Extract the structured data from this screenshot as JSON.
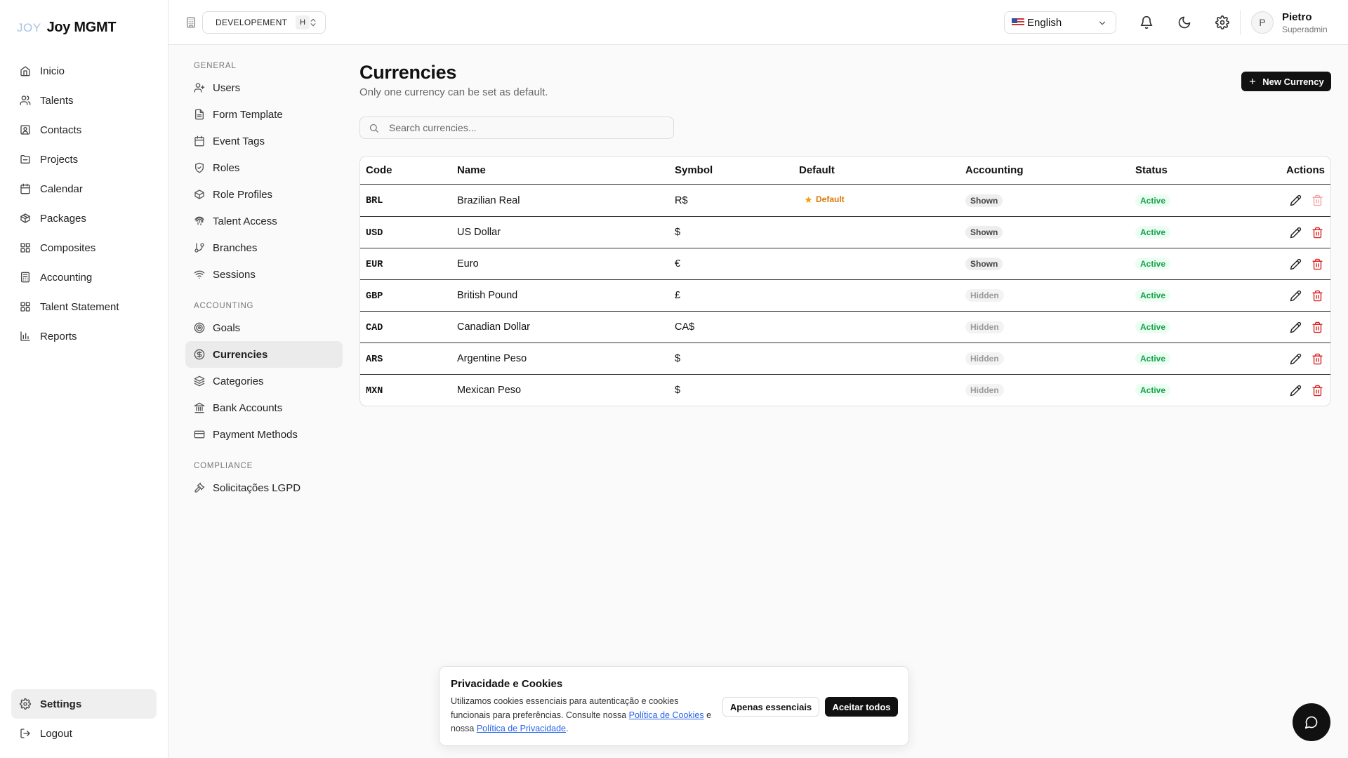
{
  "brand": {
    "logo": "JOY",
    "name": "Joy MGMT"
  },
  "sidebar": {
    "items": [
      {
        "label": "Inicio",
        "icon": "home-icon"
      },
      {
        "label": "Talents",
        "icon": "users-icon"
      },
      {
        "label": "Contacts",
        "icon": "contact-icon"
      },
      {
        "label": "Projects",
        "icon": "folder-icon"
      },
      {
        "label": "Calendar",
        "icon": "calendar-icon"
      },
      {
        "label": "Packages",
        "icon": "package-icon"
      },
      {
        "label": "Composites",
        "icon": "grid-icon"
      },
      {
        "label": "Accounting",
        "icon": "calculator-icon"
      },
      {
        "label": "Talent Statement",
        "icon": "grid-icon"
      },
      {
        "label": "Reports",
        "icon": "bar-chart-icon"
      }
    ],
    "settings_label": "Settings",
    "logout_label": "Logout"
  },
  "topbar": {
    "environment": "DEVELOPEMENT",
    "environment_badge": "H",
    "language": "English",
    "user_initial": "P",
    "user_name": "Pietro",
    "user_role": "Superadmin"
  },
  "subnav": {
    "general_label": "GENERAL",
    "general": [
      "Users",
      "Form Template",
      "Event Tags",
      "Roles",
      "Role Profiles",
      "Talent Access",
      "Branches",
      "Sessions"
    ],
    "accounting_label": "ACCOUNTING",
    "accounting": [
      "Goals",
      "Currencies",
      "Categories",
      "Bank Accounts",
      "Payment Methods"
    ],
    "compliance_label": "COMPLIANCE",
    "compliance": [
      "Solicitações LGPD"
    ]
  },
  "main": {
    "title": "Currencies",
    "subtitle": "Only one currency can be set as default.",
    "new_button": "New Currency",
    "search_placeholder": "Search currencies..."
  },
  "table": {
    "headers": {
      "code": "Code",
      "name": "Name",
      "symbol": "Symbol",
      "default": "Default",
      "accounting": "Accounting",
      "status": "Status",
      "actions": "Actions"
    },
    "rows": [
      {
        "code": "BRL",
        "name": "Brazilian Real",
        "symbol": "R$",
        "default": "Default",
        "accounting": "Shown",
        "status": "Active"
      },
      {
        "code": "USD",
        "name": "US Dollar",
        "symbol": "$",
        "default": "",
        "accounting": "Shown",
        "status": "Active"
      },
      {
        "code": "EUR",
        "name": "Euro",
        "symbol": "€",
        "default": "",
        "accounting": "Shown",
        "status": "Active"
      },
      {
        "code": "GBP",
        "name": "British Pound",
        "symbol": "£",
        "default": "",
        "accounting": "Hidden",
        "status": "Active"
      },
      {
        "code": "CAD",
        "name": "Canadian Dollar",
        "symbol": "CA$",
        "default": "",
        "accounting": "Hidden",
        "status": "Active"
      },
      {
        "code": "ARS",
        "name": "Argentine Peso",
        "symbol": "$",
        "default": "",
        "accounting": "Hidden",
        "status": "Active"
      },
      {
        "code": "MXN",
        "name": "Mexican Peso",
        "symbol": "$",
        "default": "",
        "accounting": "Hidden",
        "status": "Active"
      }
    ]
  },
  "cookie": {
    "title": "Privacidade e Cookies",
    "text_1": "Utilizamos cookies essenciais para autenticação e cookies funcionais para preferências. Consulte nossa ",
    "link_cookies": "Política de Cookies",
    "text_2": " e nossa ",
    "link_privacy": "Política de Privacidade",
    "text_3": ".",
    "essential_button": "Apenas essenciais",
    "accept_button": "Aceitar todos"
  },
  "colors": {
    "accent": "#111111",
    "danger": "#dc2626",
    "success": "#16a34a",
    "warning": "#d97706",
    "link": "#2563eb"
  }
}
